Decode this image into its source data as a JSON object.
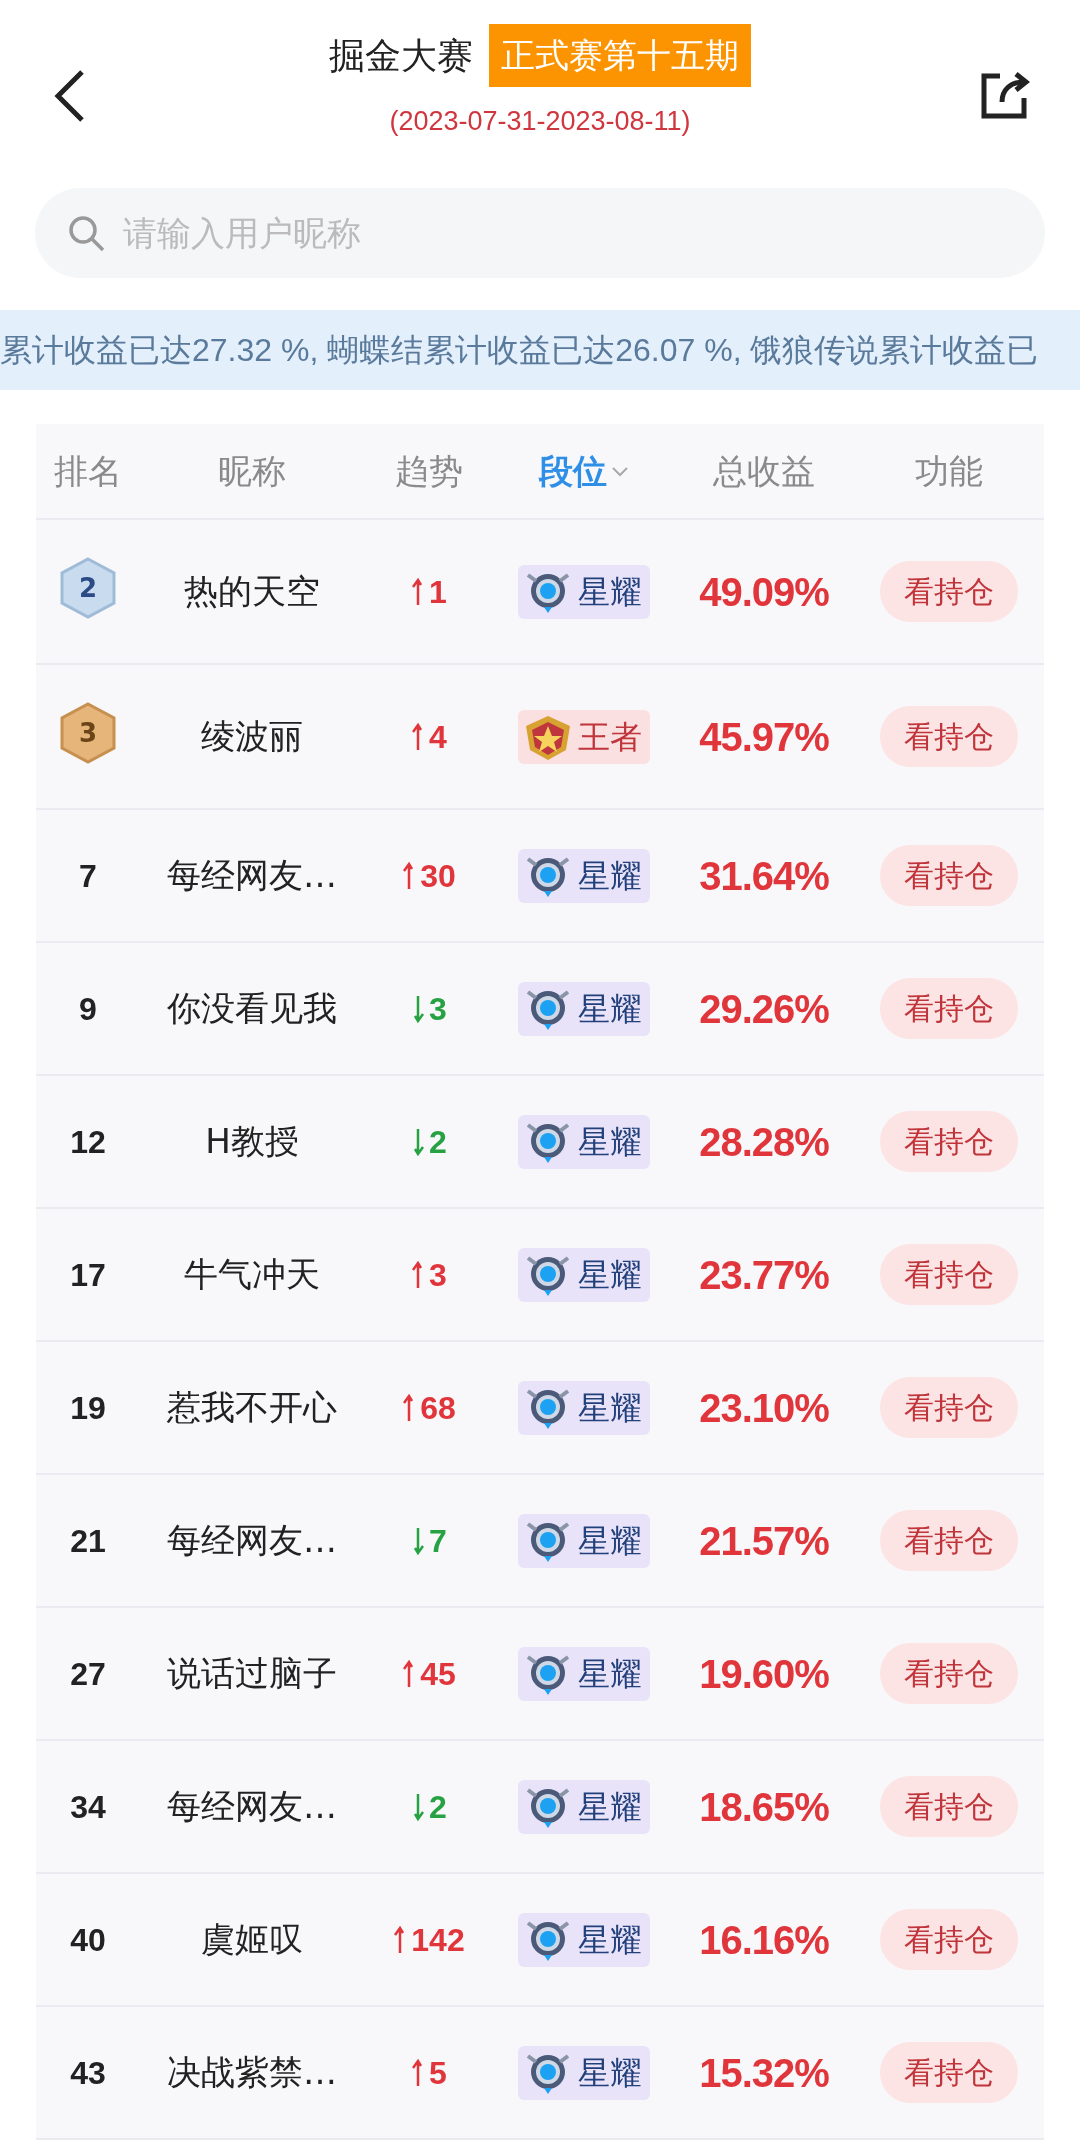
{
  "header": {
    "title": "掘金大赛",
    "badge": "正式赛第十五期",
    "date_range": "(2023-07-31-2023-08-11)"
  },
  "search": {
    "placeholder": "请输入用户昵称"
  },
  "ticker": "累计收益已达27.32 %, 蝴蝶结累计收益已达26.07 %, 饿狼传说累计收益已",
  "table": {
    "columns": [
      {
        "label": "排名",
        "selected": false
      },
      {
        "label": "昵称",
        "selected": false
      },
      {
        "label": "趋势",
        "selected": false
      },
      {
        "label": "段位",
        "selected": true
      },
      {
        "label": "总收益",
        "selected": false
      },
      {
        "label": "功能",
        "selected": false
      }
    ],
    "rows": [
      {
        "rank": {
          "kind": "silver",
          "text": "2"
        },
        "name": "热的天空",
        "trend": {
          "kind": "up",
          "text": "1"
        },
        "tier": {
          "kind": "glory",
          "text": "星耀"
        },
        "profit": "49.09%",
        "action": "看持仓"
      },
      {
        "rank": {
          "kind": "bronze",
          "text": "3"
        },
        "name": "绫波丽",
        "trend": {
          "kind": "up",
          "text": "4"
        },
        "tier": {
          "kind": "king",
          "text": "王者"
        },
        "profit": "45.97%",
        "action": "看持仓"
      },
      {
        "rank": {
          "kind": "plain",
          "text": "7"
        },
        "name": "每经网友…",
        "trend": {
          "kind": "up",
          "text": "30"
        },
        "tier": {
          "kind": "glory",
          "text": "星耀"
        },
        "profit": "31.64%",
        "action": "看持仓"
      },
      {
        "rank": {
          "kind": "plain",
          "text": "9"
        },
        "name": "你没看见我",
        "trend": {
          "kind": "down",
          "text": "3"
        },
        "tier": {
          "kind": "glory",
          "text": "星耀"
        },
        "profit": "29.26%",
        "action": "看持仓"
      },
      {
        "rank": {
          "kind": "plain",
          "text": "12"
        },
        "name": "H教授",
        "trend": {
          "kind": "down",
          "text": "2"
        },
        "tier": {
          "kind": "glory",
          "text": "星耀"
        },
        "profit": "28.28%",
        "action": "看持仓"
      },
      {
        "rank": {
          "kind": "plain",
          "text": "17"
        },
        "name": "牛气冲天",
        "trend": {
          "kind": "up",
          "text": "3"
        },
        "tier": {
          "kind": "glory",
          "text": "星耀"
        },
        "profit": "23.77%",
        "action": "看持仓"
      },
      {
        "rank": {
          "kind": "plain",
          "text": "19"
        },
        "name": "惹我不开心",
        "trend": {
          "kind": "up",
          "text": "68"
        },
        "tier": {
          "kind": "glory",
          "text": "星耀"
        },
        "profit": "23.10%",
        "action": "看持仓"
      },
      {
        "rank": {
          "kind": "plain",
          "text": "21"
        },
        "name": "每经网友…",
        "trend": {
          "kind": "down",
          "text": "7"
        },
        "tier": {
          "kind": "glory",
          "text": "星耀"
        },
        "profit": "21.57%",
        "action": "看持仓"
      },
      {
        "rank": {
          "kind": "plain",
          "text": "27"
        },
        "name": "说话过脑子",
        "trend": {
          "kind": "up",
          "text": "45"
        },
        "tier": {
          "kind": "glory",
          "text": "星耀"
        },
        "profit": "19.60%",
        "action": "看持仓"
      },
      {
        "rank": {
          "kind": "plain",
          "text": "34"
        },
        "name": "每经网友…",
        "trend": {
          "kind": "down",
          "text": "2"
        },
        "tier": {
          "kind": "glory",
          "text": "星耀"
        },
        "profit": "18.65%",
        "action": "看持仓"
      },
      {
        "rank": {
          "kind": "plain",
          "text": "40"
        },
        "name": "虞姬叹",
        "trend": {
          "kind": "up",
          "text": "142"
        },
        "tier": {
          "kind": "glory",
          "text": "星耀"
        },
        "profit": "16.16%",
        "action": "看持仓"
      },
      {
        "rank": {
          "kind": "plain",
          "text": "43"
        },
        "name": "决战紫禁…",
        "trend": {
          "kind": "up",
          "text": "5"
        },
        "tier": {
          "kind": "glory",
          "text": "星耀"
        },
        "profit": "15.32%",
        "action": "看持仓"
      }
    ]
  }
}
